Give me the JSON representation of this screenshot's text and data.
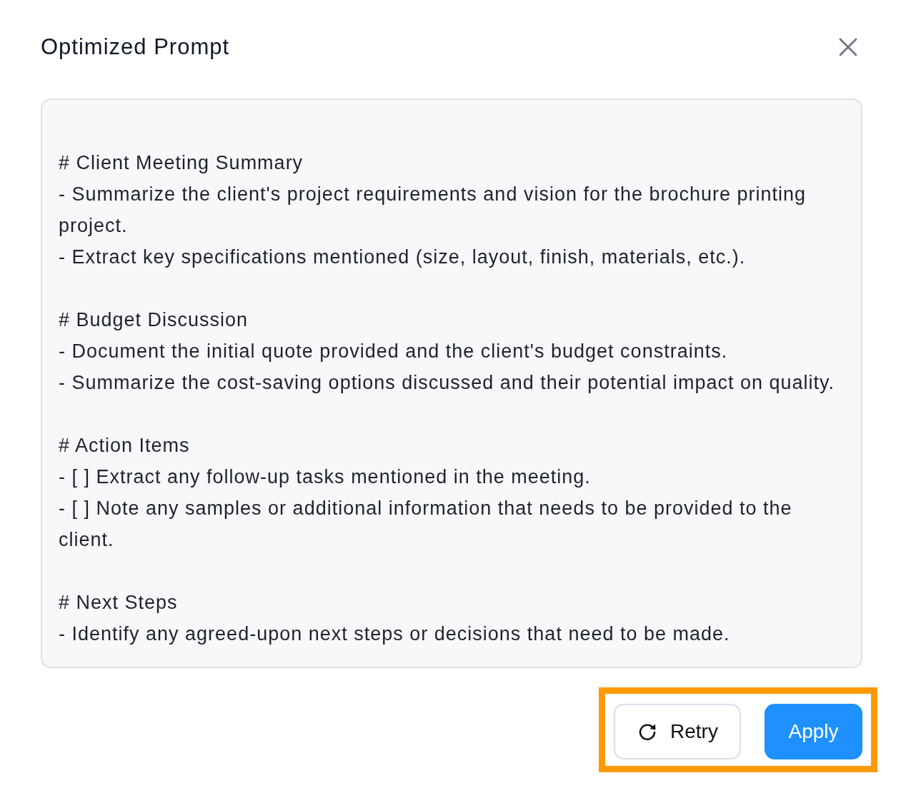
{
  "dialog": {
    "title": "Optimized Prompt"
  },
  "prompt": {
    "sections": [
      {
        "heading": "# Client Meeting Summary",
        "lines": [
          "- Summarize the client's project requirements and vision for the brochure printing project.",
          "- Extract key specifications mentioned (size, layout, finish, materials, etc.)."
        ]
      },
      {
        "heading": "# Budget Discussion",
        "lines": [
          "- Document the initial quote provided and the client's budget constraints.",
          "- Summarize the cost-saving options discussed and their potential impact on quality."
        ]
      },
      {
        "heading": "# Action Items",
        "lines": [
          "- [ ] Extract any follow-up tasks mentioned in the meeting.",
          "- [ ] Note any samples or additional information that needs to be provided to the client."
        ]
      },
      {
        "heading": "# Next Steps",
        "lines": [
          "- Identify any agreed-upon next steps or decisions that need to be made."
        ]
      }
    ]
  },
  "actions": {
    "highlighted": true,
    "buttons": [
      {
        "label": "Retry",
        "kind": "secondary"
      },
      {
        "label": "Apply",
        "kind": "primary"
      }
    ]
  }
}
